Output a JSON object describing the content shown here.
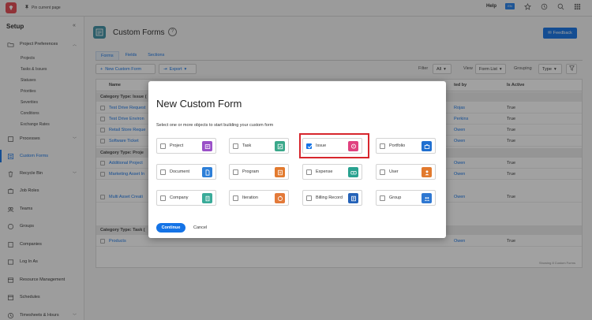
{
  "topbar": {
    "pin_label": "Pin current page",
    "help": "Help",
    "lang": "EN"
  },
  "sidebar": {
    "title": "Setup",
    "sections": [
      {
        "label": "Project Preferences"
      },
      {
        "label": "Processes"
      },
      {
        "label": "Custom Forms"
      },
      {
        "label": "Recycle Bin"
      },
      {
        "label": "Job Roles"
      },
      {
        "label": "Teams"
      },
      {
        "label": "Groups"
      },
      {
        "label": "Companies"
      },
      {
        "label": "Log In As"
      },
      {
        "label": "Resource Management"
      },
      {
        "label": "Schedules"
      },
      {
        "label": "Timesheets & Hours"
      }
    ],
    "sub_items": [
      "Projects",
      "Tasks & Issues",
      "Statuses",
      "Priorities",
      "Severities",
      "Conditions",
      "Exchange Rates"
    ]
  },
  "main": {
    "title": "Custom Forms",
    "feedback": "Feedback",
    "tabs": [
      "Forms",
      "Fields",
      "Sections"
    ],
    "toolbar": {
      "new_form": "New Custom Form",
      "export": "Export",
      "filter_label": "Filter",
      "filter_value": "All",
      "view_label": "View",
      "view_value": "Form List",
      "grouping_label": "Grouping",
      "grouping_value": "Type"
    },
    "table": {
      "col_name": "Name",
      "col_by": "ted by",
      "col_active": "Is Active",
      "cat1": "Category Type: Issue (",
      "cat2": "Category Type: Proje",
      "cat3": "Category Type: Task (",
      "rows": [
        {
          "name": "Test Drive Request",
          "by": "Rojas",
          "active": "True"
        },
        {
          "name": "Test Drive Environ",
          "by": "Perkins",
          "active": "True"
        },
        {
          "name": "Retail Store Reque",
          "by": "Owen",
          "active": "True"
        },
        {
          "name": "Software Ticket",
          "by": "Owen",
          "active": "True"
        },
        {
          "name": "Additional Project",
          "by": "Owen",
          "active": "True"
        },
        {
          "name": "Marketing Asset In",
          "by": "Owen",
          "active": "True"
        },
        {
          "name": "Multi Asset Creati",
          "by": "Owen",
          "active": "True"
        },
        {
          "name": "Products",
          "by": "Owen",
          "active": "True"
        }
      ],
      "showing": "Showing 8 Custom Forms"
    }
  },
  "modal": {
    "title": "New Custom Form",
    "subtitle": "Select one or more objects to start building your custom form",
    "options": [
      {
        "label": "Project",
        "checked": false,
        "color": "#9a50c8",
        "icon": "project-icon"
      },
      {
        "label": "Task",
        "checked": false,
        "color": "#3aa88a",
        "icon": "task-icon"
      },
      {
        "label": "Issue",
        "checked": true,
        "color": "#e0417f",
        "icon": "issue-icon"
      },
      {
        "label": "Portfolio",
        "checked": false,
        "color": "#1f6fd0",
        "icon": "portfolio-icon"
      },
      {
        "label": "Document",
        "checked": false,
        "color": "#2d7fd8",
        "icon": "document-icon"
      },
      {
        "label": "Program",
        "checked": false,
        "color": "#e27a2e",
        "icon": "program-icon"
      },
      {
        "label": "Expense",
        "checked": false,
        "color": "#2aa290",
        "icon": "expense-icon"
      },
      {
        "label": "User",
        "checked": false,
        "color": "#e27a2e",
        "icon": "user-icon"
      },
      {
        "label": "Company",
        "checked": false,
        "color": "#3aab99",
        "icon": "company-icon"
      },
      {
        "label": "Iteration",
        "checked": false,
        "color": "#e37a3a",
        "icon": "iteration-icon"
      },
      {
        "label": "Billing Record",
        "checked": false,
        "color": "#2462b8",
        "icon": "billing-record-icon"
      },
      {
        "label": "Group",
        "checked": false,
        "color": "#2f78d2",
        "icon": "group-icon"
      }
    ],
    "continue": "Continue",
    "cancel": "Cancel"
  },
  "colors": {
    "accent": "#1473e6",
    "highlight": "#d7262d"
  }
}
